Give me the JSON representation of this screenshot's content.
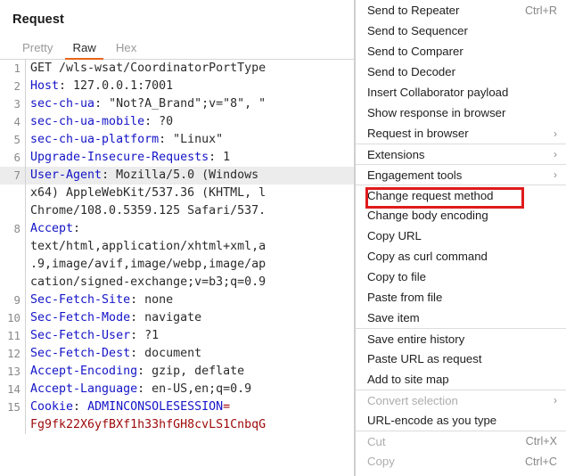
{
  "request_panel": {
    "title": "Request",
    "tabs": [
      {
        "label": "Pretty",
        "active": false
      },
      {
        "label": "Raw",
        "active": true
      },
      {
        "label": "Hex",
        "active": false
      }
    ],
    "lines": [
      {
        "num": "1",
        "highlight": false,
        "spans": [
          {
            "text": "GET /wls-wsat/CoordinatorPortType",
            "cls": "v"
          }
        ]
      },
      {
        "num": "2",
        "highlight": false,
        "spans": [
          {
            "text": "Host",
            "cls": "k"
          },
          {
            "text": ": 127.0.0.1:7001",
            "cls": "v"
          }
        ]
      },
      {
        "num": "3",
        "highlight": false,
        "spans": [
          {
            "text": "sec-ch-ua",
            "cls": "k"
          },
          {
            "text": ": \"Not?A_Brand\";v=\"8\", \"",
            "cls": "v"
          }
        ]
      },
      {
        "num": "4",
        "highlight": false,
        "spans": [
          {
            "text": "sec-ch-ua-mobile",
            "cls": "k"
          },
          {
            "text": ": ?0",
            "cls": "v"
          }
        ]
      },
      {
        "num": "5",
        "highlight": false,
        "spans": [
          {
            "text": "sec-ch-ua-platform",
            "cls": "k"
          },
          {
            "text": ": \"Linux\"",
            "cls": "v"
          }
        ]
      },
      {
        "num": "6",
        "highlight": false,
        "spans": [
          {
            "text": "Upgrade-Insecure-Requests",
            "cls": "k"
          },
          {
            "text": ": 1",
            "cls": "v"
          }
        ]
      },
      {
        "num": "7",
        "highlight": true,
        "spans": [
          {
            "text": "User-Agent",
            "cls": "k"
          },
          {
            "text": ": Mozilla/5.0 (Windows",
            "cls": "v"
          }
        ]
      },
      {
        "num": "",
        "highlight": false,
        "spans": [
          {
            "text": "x64) AppleWebKit/537.36 (KHTML, l",
            "cls": "v"
          }
        ]
      },
      {
        "num": "",
        "highlight": false,
        "spans": [
          {
            "text": "Chrome/108.0.5359.125 Safari/537.",
            "cls": "v"
          }
        ]
      },
      {
        "num": "8",
        "highlight": false,
        "spans": [
          {
            "text": "Accept",
            "cls": "k"
          },
          {
            "text": ":",
            "cls": "v"
          }
        ]
      },
      {
        "num": "",
        "highlight": false,
        "spans": [
          {
            "text": "text/html,application/xhtml+xml,a",
            "cls": "v"
          }
        ]
      },
      {
        "num": "",
        "highlight": false,
        "spans": [
          {
            "text": ".9,image/avif,image/webp,image/ap",
            "cls": "v"
          }
        ]
      },
      {
        "num": "",
        "highlight": false,
        "spans": [
          {
            "text": "cation/signed-exchange;v=b3;q=0.9",
            "cls": "v"
          }
        ]
      },
      {
        "num": "9",
        "highlight": false,
        "spans": [
          {
            "text": "Sec-Fetch-Site",
            "cls": "k"
          },
          {
            "text": ": none",
            "cls": "v"
          }
        ]
      },
      {
        "num": "10",
        "highlight": false,
        "spans": [
          {
            "text": "Sec-Fetch-Mode",
            "cls": "k"
          },
          {
            "text": ": navigate",
            "cls": "v"
          }
        ]
      },
      {
        "num": "11",
        "highlight": false,
        "spans": [
          {
            "text": "Sec-Fetch-User",
            "cls": "k"
          },
          {
            "text": ": ?1",
            "cls": "v"
          }
        ]
      },
      {
        "num": "12",
        "highlight": false,
        "spans": [
          {
            "text": "Sec-Fetch-Dest",
            "cls": "k"
          },
          {
            "text": ": document",
            "cls": "v"
          }
        ]
      },
      {
        "num": "13",
        "highlight": false,
        "spans": [
          {
            "text": "Accept-Encoding",
            "cls": "k"
          },
          {
            "text": ": gzip, deflate",
            "cls": "v"
          }
        ]
      },
      {
        "num": "14",
        "highlight": false,
        "spans": [
          {
            "text": "Accept-Language",
            "cls": "k"
          },
          {
            "text": ": en-US,en;q=0.9",
            "cls": "v"
          }
        ]
      },
      {
        "num": "15",
        "highlight": false,
        "spans": [
          {
            "text": "Cookie",
            "cls": "k"
          },
          {
            "text": ": ",
            "cls": "v"
          },
          {
            "text": "ADMINCONSOLESESSION",
            "cls": "kb"
          },
          {
            "text": "=",
            "cls": "r"
          }
        ]
      },
      {
        "num": "",
        "highlight": false,
        "spans": [
          {
            "text": "Fg9fk22X6yfBXf1h33hfGH8cvLS1CnbqG",
            "cls": "r"
          }
        ]
      }
    ]
  },
  "context_menu": {
    "items": [
      {
        "label": "Send to Repeater",
        "shortcut": "Ctrl+R",
        "submenu": false,
        "disabled": false,
        "separator_above": false
      },
      {
        "label": "Send to Sequencer",
        "shortcut": "",
        "submenu": false,
        "disabled": false,
        "separator_above": false
      },
      {
        "label": "Send to Comparer",
        "shortcut": "",
        "submenu": false,
        "disabled": false,
        "separator_above": false
      },
      {
        "label": "Send to Decoder",
        "shortcut": "",
        "submenu": false,
        "disabled": false,
        "separator_above": false
      },
      {
        "label": "Insert Collaborator payload",
        "shortcut": "",
        "submenu": false,
        "disabled": false,
        "separator_above": false
      },
      {
        "label": "Show response in browser",
        "shortcut": "",
        "submenu": false,
        "disabled": false,
        "separator_above": false
      },
      {
        "label": "Request in browser",
        "shortcut": "",
        "submenu": true,
        "disabled": false,
        "separator_above": false
      },
      {
        "label": "Extensions",
        "shortcut": "",
        "submenu": true,
        "disabled": false,
        "separator_above": true
      },
      {
        "label": "Engagement tools",
        "shortcut": "",
        "submenu": true,
        "disabled": false,
        "separator_above": true
      },
      {
        "label": "Change request method",
        "shortcut": "",
        "submenu": false,
        "disabled": false,
        "separator_above": true
      },
      {
        "label": "Change body encoding",
        "shortcut": "",
        "submenu": false,
        "disabled": false,
        "separator_above": false
      },
      {
        "label": "Copy URL",
        "shortcut": "",
        "submenu": false,
        "disabled": false,
        "separator_above": false
      },
      {
        "label": "Copy as curl command",
        "shortcut": "",
        "submenu": false,
        "disabled": false,
        "separator_above": false
      },
      {
        "label": "Copy to file",
        "shortcut": "",
        "submenu": false,
        "disabled": false,
        "separator_above": false
      },
      {
        "label": "Paste from file",
        "shortcut": "",
        "submenu": false,
        "disabled": false,
        "separator_above": false
      },
      {
        "label": "Save item",
        "shortcut": "",
        "submenu": false,
        "disabled": false,
        "separator_above": false
      },
      {
        "label": "Save entire history",
        "shortcut": "",
        "submenu": false,
        "disabled": false,
        "separator_above": true
      },
      {
        "label": "Paste URL as request",
        "shortcut": "",
        "submenu": false,
        "disabled": false,
        "separator_above": false
      },
      {
        "label": "Add to site map",
        "shortcut": "",
        "submenu": false,
        "disabled": false,
        "separator_above": false
      },
      {
        "label": "Convert selection",
        "shortcut": "",
        "submenu": true,
        "disabled": true,
        "separator_above": true
      },
      {
        "label": "URL-encode as you type",
        "shortcut": "",
        "submenu": false,
        "disabled": false,
        "separator_above": false
      },
      {
        "label": "Cut",
        "shortcut": "Ctrl+X",
        "submenu": false,
        "disabled": true,
        "separator_above": true
      },
      {
        "label": "Copy",
        "shortcut": "Ctrl+C",
        "submenu": false,
        "disabled": true,
        "separator_above": false
      }
    ]
  },
  "annotation": {
    "target_label": "Change request method",
    "color": "#e01b1b"
  }
}
